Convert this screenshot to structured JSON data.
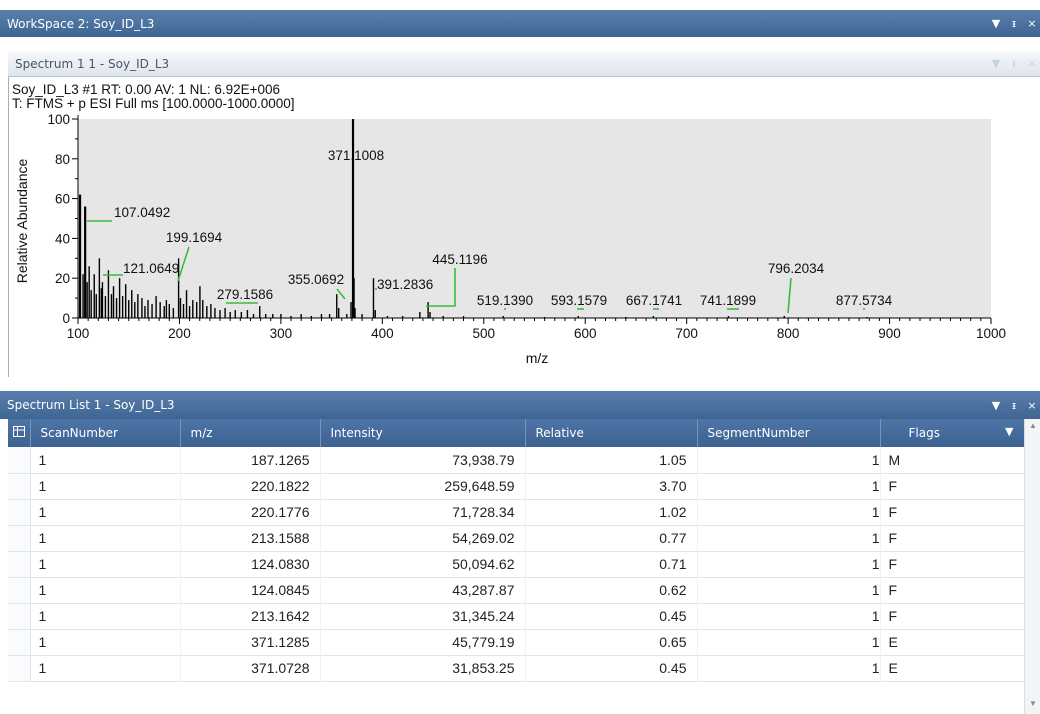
{
  "workspace": {
    "title": "WorkSpace 2: Soy_ID_L3"
  },
  "window_controls": {
    "dropdown": "▼",
    "pin": "ᵻ",
    "close": "×"
  },
  "spectrum_panel": {
    "title": "Spectrum  1  1 - Soy_ID_L3",
    "info_line1": "Soy_ID_L3 #1 RT: 0.00 AV: 1 NL: 6.92E+006",
    "info_line2": "T: FTMS + p ESI Full ms [100.0000-1000.0000]"
  },
  "chart_data": {
    "type": "line",
    "title": "",
    "xlabel": "m/z",
    "ylabel": "Relative Abundance",
    "xlim": [
      100,
      1000
    ],
    "ylim": [
      0,
      100
    ],
    "xticks": [
      100,
      200,
      300,
      400,
      500,
      600,
      700,
      800,
      900,
      1000
    ],
    "yticks": [
      0,
      20,
      40,
      60,
      80,
      100
    ],
    "grid": false,
    "background": "#e6e6e6",
    "peaks": [
      {
        "x": 102.0,
        "y": 62
      },
      {
        "x": 105.0,
        "y": 22
      },
      {
        "x": 107.05,
        "y": 56
      },
      {
        "x": 109.0,
        "y": 18
      },
      {
        "x": 111.0,
        "y": 26
      },
      {
        "x": 113.0,
        "y": 14
      },
      {
        "x": 116.0,
        "y": 22
      },
      {
        "x": 118.0,
        "y": 12
      },
      {
        "x": 121.06,
        "y": 30
      },
      {
        "x": 123.0,
        "y": 15
      },
      {
        "x": 124.08,
        "y": 18
      },
      {
        "x": 127.0,
        "y": 11
      },
      {
        "x": 130.0,
        "y": 24
      },
      {
        "x": 133.0,
        "y": 12
      },
      {
        "x": 135.0,
        "y": 16
      },
      {
        "x": 138.0,
        "y": 10
      },
      {
        "x": 141.0,
        "y": 20
      },
      {
        "x": 144.0,
        "y": 11
      },
      {
        "x": 147.0,
        "y": 17
      },
      {
        "x": 150.0,
        "y": 9
      },
      {
        "x": 153.0,
        "y": 14
      },
      {
        "x": 156.0,
        "y": 8
      },
      {
        "x": 159.0,
        "y": 12
      },
      {
        "x": 163.0,
        "y": 10
      },
      {
        "x": 166.0,
        "y": 6
      },
      {
        "x": 169.0,
        "y": 9
      },
      {
        "x": 173.0,
        "y": 7
      },
      {
        "x": 177.0,
        "y": 11
      },
      {
        "x": 181.0,
        "y": 8
      },
      {
        "x": 185.0,
        "y": 6
      },
      {
        "x": 187.13,
        "y": 9
      },
      {
        "x": 190.0,
        "y": 7
      },
      {
        "x": 194.0,
        "y": 5
      },
      {
        "x": 199.17,
        "y": 30
      },
      {
        "x": 201.0,
        "y": 10
      },
      {
        "x": 204.0,
        "y": 7
      },
      {
        "x": 207.0,
        "y": 14
      },
      {
        "x": 210.0,
        "y": 6
      },
      {
        "x": 213.16,
        "y": 9
      },
      {
        "x": 217.0,
        "y": 8
      },
      {
        "x": 220.18,
        "y": 16
      },
      {
        "x": 223.0,
        "y": 9
      },
      {
        "x": 227.0,
        "y": 6
      },
      {
        "x": 231.0,
        "y": 7
      },
      {
        "x": 235.0,
        "y": 5
      },
      {
        "x": 240.0,
        "y": 4
      },
      {
        "x": 245.0,
        "y": 5
      },
      {
        "x": 250.0,
        "y": 3
      },
      {
        "x": 255.0,
        "y": 4
      },
      {
        "x": 261.0,
        "y": 3
      },
      {
        "x": 267.0,
        "y": 4
      },
      {
        "x": 273.0,
        "y": 2
      },
      {
        "x": 279.16,
        "y": 6
      },
      {
        "x": 285.0,
        "y": 2
      },
      {
        "x": 292.0,
        "y": 2
      },
      {
        "x": 300.0,
        "y": 2
      },
      {
        "x": 310.0,
        "y": 1
      },
      {
        "x": 320.0,
        "y": 2
      },
      {
        "x": 330.0,
        "y": 1
      },
      {
        "x": 340.0,
        "y": 2
      },
      {
        "x": 348.0,
        "y": 2
      },
      {
        "x": 355.07,
        "y": 12
      },
      {
        "x": 357.0,
        "y": 5
      },
      {
        "x": 365.0,
        "y": 2
      },
      {
        "x": 369.1,
        "y": 8
      },
      {
        "x": 371.1,
        "y": 100
      },
      {
        "x": 372.1,
        "y": 20
      },
      {
        "x": 373.1,
        "y": 5
      },
      {
        "x": 380.0,
        "y": 2
      },
      {
        "x": 391.28,
        "y": 20
      },
      {
        "x": 393.0,
        "y": 4
      },
      {
        "x": 405.0,
        "y": 1
      },
      {
        "x": 420.0,
        "y": 1
      },
      {
        "x": 437.0,
        "y": 3
      },
      {
        "x": 445.12,
        "y": 8
      },
      {
        "x": 447.0,
        "y": 3
      },
      {
        "x": 460.0,
        "y": 1
      },
      {
        "x": 480.0,
        "y": 1
      },
      {
        "x": 519.14,
        "y": 1
      },
      {
        "x": 560.0,
        "y": 0.5
      },
      {
        "x": 593.16,
        "y": 1
      },
      {
        "x": 640.0,
        "y": 0.5
      },
      {
        "x": 667.17,
        "y": 1
      },
      {
        "x": 741.19,
        "y": 1
      },
      {
        "x": 796.2,
        "y": 1
      },
      {
        "x": 877.57,
        "y": 0.5
      }
    ],
    "annotations": [
      {
        "label": "371.1008",
        "x": 371.1008,
        "y": 100
      },
      {
        "label": "107.0492",
        "x": 107.0492,
        "y": 56
      },
      {
        "label": "199.1694",
        "x": 199.1694,
        "y": 30
      },
      {
        "label": "121.0649",
        "x": 121.0649,
        "y": 30
      },
      {
        "label": "279.1586",
        "x": 279.1586,
        "y": 6
      },
      {
        "label": "355.0692",
        "x": 355.0692,
        "y": 12
      },
      {
        "label": "391.2836",
        "x": 391.2836,
        "y": 20
      },
      {
        "label": "445.1196",
        "x": 445.1196,
        "y": 8
      },
      {
        "label": "519.1390",
        "x": 519.139,
        "y": 1
      },
      {
        "label": "593.1579",
        "x": 593.1579,
        "y": 1
      },
      {
        "label": "667.1741",
        "x": 667.1741,
        "y": 1
      },
      {
        "label": "741.1899",
        "x": 741.1899,
        "y": 1
      },
      {
        "label": "796.2034",
        "x": 796.2034,
        "y": 1
      },
      {
        "label": "877.5734",
        "x": 877.5734,
        "y": 0.5
      }
    ]
  },
  "spectrum_list": {
    "title": "Spectrum List  1 - Soy_ID_L3",
    "columns": {
      "scan_number": "ScanNumber",
      "mz": "m/z",
      "intensity": "Intensity",
      "relative": "Relative",
      "segment_number": "SegmentNumber",
      "flags": "Flags"
    },
    "rows": [
      {
        "scan": "1",
        "mz": "187.1265",
        "intensity": "73,938.79",
        "relative": "1.05",
        "segment": "1",
        "flag": "M"
      },
      {
        "scan": "1",
        "mz": "220.1822",
        "intensity": "259,648.59",
        "relative": "3.70",
        "segment": "1",
        "flag": "F"
      },
      {
        "scan": "1",
        "mz": "220.1776",
        "intensity": "71,728.34",
        "relative": "1.02",
        "segment": "1",
        "flag": "F"
      },
      {
        "scan": "1",
        "mz": "213.1588",
        "intensity": "54,269.02",
        "relative": "0.77",
        "segment": "1",
        "flag": "F"
      },
      {
        "scan": "1",
        "mz": "124.0830",
        "intensity": "50,094.62",
        "relative": "0.71",
        "segment": "1",
        "flag": "F"
      },
      {
        "scan": "1",
        "mz": "124.0845",
        "intensity": "43,287.87",
        "relative": "0.62",
        "segment": "1",
        "flag": "F"
      },
      {
        "scan": "1",
        "mz": "213.1642",
        "intensity": "31,345.24",
        "relative": "0.45",
        "segment": "1",
        "flag": "F"
      },
      {
        "scan": "1",
        "mz": "371.1285",
        "intensity": "45,779.19",
        "relative": "0.65",
        "segment": "1",
        "flag": "E"
      },
      {
        "scan": "1",
        "mz": "371.0728",
        "intensity": "31,853.25",
        "relative": "0.45",
        "segment": "1",
        "flag": "E"
      }
    ]
  },
  "colors": {
    "titlebar": "#4a71a0",
    "plot_background": "#e6e6e6",
    "annotation_leader": "#3cbc3c",
    "peak": "#000000"
  }
}
